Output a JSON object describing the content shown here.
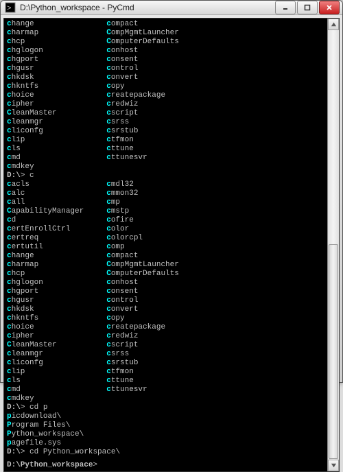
{
  "window": {
    "title": "D:\\Python_workspace - PyCmd"
  },
  "block1_cols": [
    [
      "change",
      "charmap",
      "chcp",
      "chglogon",
      "chgport",
      "chgusr",
      "chkdsk",
      "chkntfs",
      "choice",
      "cipher",
      "CleanMaster",
      "cleanmgr",
      "cliconfg",
      "clip",
      "cls",
      "cmd",
      "cmdkey"
    ],
    [
      "compact",
      "CompMgmtLauncher",
      "ComputerDefaults",
      "conhost",
      "consent",
      "control",
      "convert",
      "copy",
      "createpackage",
      "credwiz",
      "cscript",
      "csrss",
      "csrstub",
      "ctfmon",
      "cttune",
      "cttunesvr"
    ]
  ],
  "prompt1": {
    "path": "D:\\",
    "cmd": "c"
  },
  "block2_cols": [
    [
      "cacls",
      "calc",
      "call",
      "CapabilityManager",
      "cd",
      "certEnrollCtrl",
      "certreq",
      "certutil",
      "change",
      "charmap",
      "chcp",
      "chglogon",
      "chgport",
      "chgusr",
      "chkdsk",
      "chkntfs",
      "choice",
      "cipher",
      "CleanMaster",
      "cleanmgr",
      "cliconfg",
      "clip",
      "cls",
      "cmd",
      "cmdkey"
    ],
    [
      "cmdl32",
      "cmmon32",
      "cmp",
      "cmstp",
      "cofire",
      "color",
      "colorcpl",
      "comp",
      "compact",
      "CompMgmtLauncher",
      "ComputerDefaults",
      "conhost",
      "consent",
      "control",
      "convert",
      "copy",
      "createpackage",
      "credwiz",
      "cscript",
      "csrss",
      "csrstub",
      "ctfmon",
      "cttune",
      "cttunesvr"
    ]
  ],
  "prompt2": {
    "path": "D:\\",
    "cmd": "cd p"
  },
  "dir_list": [
    "picdownload\\",
    "Program Files\\",
    "Python_workspace\\",
    "pagefile.sys"
  ],
  "prompt3": {
    "path": "D:\\",
    "cmd": "cd Python_workspace\\"
  },
  "prompt4": {
    "path": "D:\\Python_workspace",
    "cmd": ""
  }
}
